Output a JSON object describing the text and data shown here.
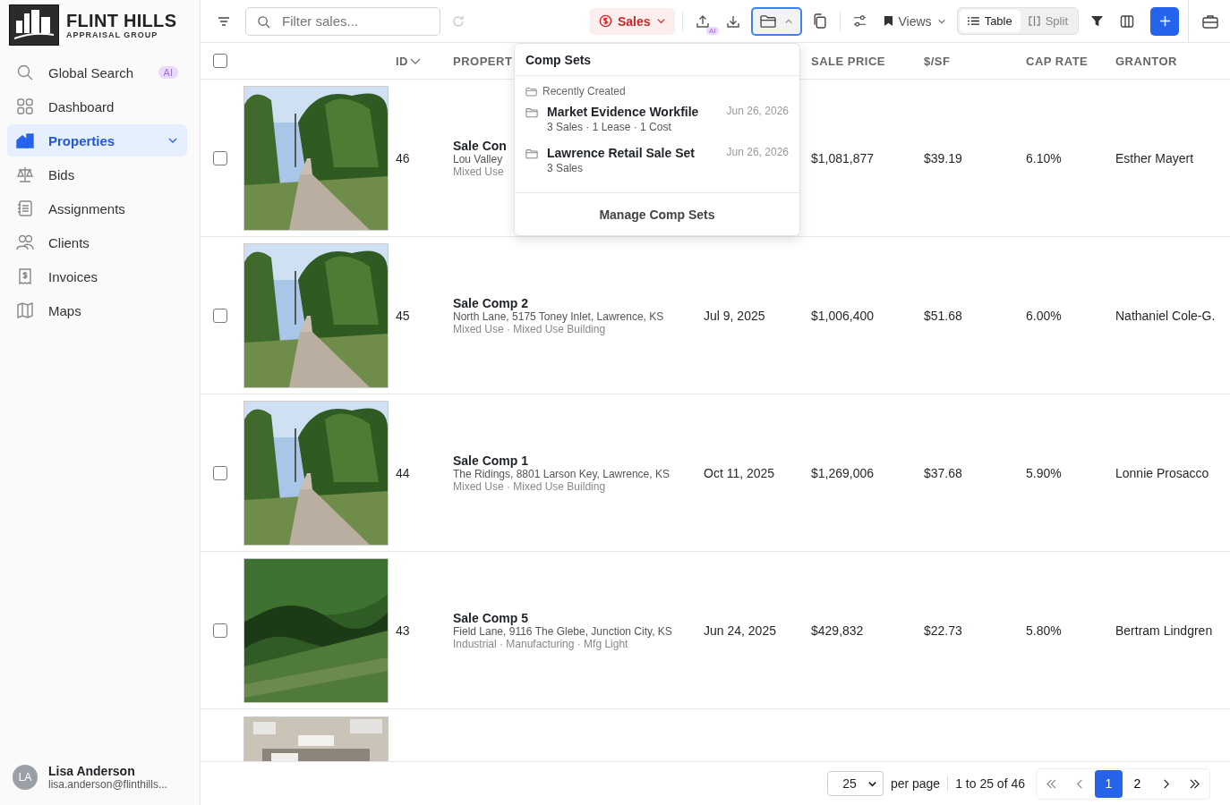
{
  "brand": {
    "name": "FLINT HILLS",
    "tagline": "APPRAISAL GROUP"
  },
  "sidebar": {
    "items": [
      {
        "kind": "search",
        "label": "Global Search",
        "badge": "AI",
        "selected": false,
        "submenu": false
      },
      {
        "kind": "dashboard",
        "label": "Dashboard",
        "selected": false,
        "submenu": false
      },
      {
        "kind": "properties",
        "label": "Properties",
        "selected": true,
        "submenu": true
      },
      {
        "kind": "bids",
        "label": "Bids",
        "selected": false,
        "submenu": false
      },
      {
        "kind": "assignments",
        "label": "Assignments",
        "selected": false,
        "submenu": false
      },
      {
        "kind": "clients",
        "label": "Clients",
        "selected": false,
        "submenu": false
      },
      {
        "kind": "invoices",
        "label": "Invoices",
        "selected": false,
        "submenu": false
      },
      {
        "kind": "maps",
        "label": "Maps",
        "selected": false,
        "submenu": false
      }
    ]
  },
  "user": {
    "initials": "LA",
    "name": "Lisa Anderson",
    "email": "lisa.anderson@flinthills..."
  },
  "toolbar": {
    "filter_placeholder": "Filter sales...",
    "type_menu": "Sales",
    "upload_badge": "AI",
    "comp_sets_open": true,
    "views": "Views",
    "view_modes": [
      {
        "kind": "table",
        "label": "Table",
        "selected": true
      },
      {
        "kind": "split",
        "label": "Split",
        "selected": false
      }
    ]
  },
  "table": {
    "header": {
      "all_selected": false,
      "id": "ID",
      "id_sorted": true,
      "property": "PROPERT",
      "sale_price": "SALE PRICE",
      "price_per_sf": "$/SF",
      "cap_rate": "CAP RATE",
      "grantor": "GRANTOR"
    },
    "rows": [
      {
        "selected": false,
        "id": "46",
        "name": "Sale Con",
        "address": "Lou Valley",
        "use": "Mixed Use",
        "sale_price": "$1,081,877",
        "price_per_sf": "$39.19",
        "cap_rate": "6.10%",
        "grantor": "Esther Mayert"
      },
      {
        "selected": false,
        "id": "45",
        "name": "Sale Comp 2",
        "address": "North Lane, 5175 Toney Inlet, Lawrence, KS",
        "use": "Mixed Use · Mixed Use Building",
        "date": "Jul 9, 2025",
        "sale_price": "$1,006,400",
        "price_per_sf": "$51.68",
        "cap_rate": "6.00%",
        "grantor": "Nathaniel Cole-G."
      },
      {
        "selected": false,
        "id": "44",
        "name": "Sale Comp 1",
        "address": "The Ridings, 8801 Larson Key, Lawrence, KS",
        "use": "Mixed Use · Mixed Use Building",
        "date": "Oct 11, 2025",
        "sale_price": "$1,269,006",
        "price_per_sf": "$37.68",
        "cap_rate": "5.90%",
        "grantor": "Lonnie Prosacco"
      },
      {
        "selected": false,
        "id": "43",
        "name": "Sale Comp 5",
        "address": "Field Lane, 9116 The Glebe, Junction City, KS",
        "use": "Industrial · Manufacturing · Mfg Light",
        "date": "Jun 24, 2025",
        "sale_price": "$429,832",
        "price_per_sf": "$22.73",
        "cap_rate": "5.80%",
        "grantor": "Bertram Lindgren"
      }
    ]
  },
  "comp_sets": {
    "title": "Comp Sets",
    "section": "Recently Created",
    "items": [
      {
        "name": "Market Evidence Workfile",
        "summary": "3 Sales · 1 Lease · 1 Cost",
        "date": "Jun 26, 2026"
      },
      {
        "name": "Lawrence Retail Sale Set",
        "summary": "3 Sales",
        "date": "Jun 26, 2026"
      }
    ],
    "footer": "Manage Comp Sets"
  },
  "pagination": {
    "per_page": "25",
    "per_page_label": "per page",
    "range": "1 to 25 of 46",
    "pages": [
      {
        "label": "1",
        "selected": true
      },
      {
        "label": "2",
        "selected": false
      }
    ]
  }
}
